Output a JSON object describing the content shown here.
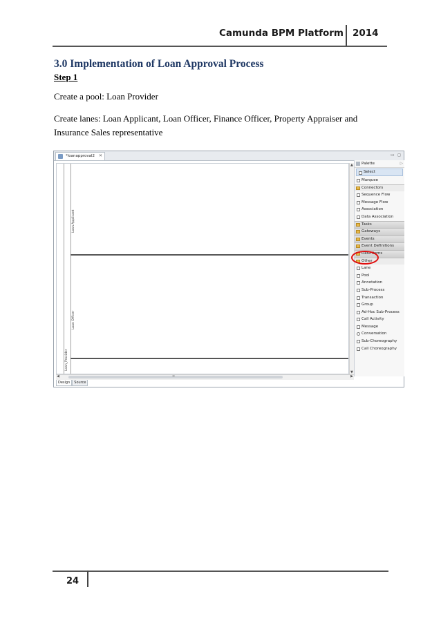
{
  "header": {
    "title": "Camunda BPM Platform",
    "year": "2014"
  },
  "section": {
    "title": "3.0 Implementation of Loan Approval Process",
    "step": "Step 1",
    "para1": "Create a pool: Loan Provider",
    "para2": "Create lanes: Loan Applicant, Loan Officer, Finance Officer, Property Appraiser and Insurance Sales representative"
  },
  "screenshot": {
    "tab_title": "*loanapproval2",
    "tab_close": "✕",
    "lanes": [
      "Loan Applicant",
      "Loan Officer"
    ],
    "pool": "Loan_Provider",
    "bottom_tabs": [
      "Design",
      "Source"
    ],
    "palette": {
      "title": "Palette",
      "tools": [
        "Select",
        "Marquee"
      ],
      "connectors_label": "Connectors",
      "connectors": [
        "Sequence Flow",
        "Message Flow",
        "Association",
        "Data Association"
      ],
      "drawers": [
        "Tasks",
        "Gateways",
        "Events",
        "Event Definitions",
        "Data Items"
      ],
      "other_label": "Other",
      "other": [
        "Lane",
        "Pool",
        "Annotation",
        "Sub-Process",
        "Transaction",
        "Group",
        "Ad-Hoc Sub-Process",
        "Call Activity",
        "Message",
        "Conversation",
        "Sub-Choreography",
        "Call Choreography"
      ]
    },
    "highlight_color": "#e01010"
  },
  "footer": {
    "page_number": "24"
  }
}
